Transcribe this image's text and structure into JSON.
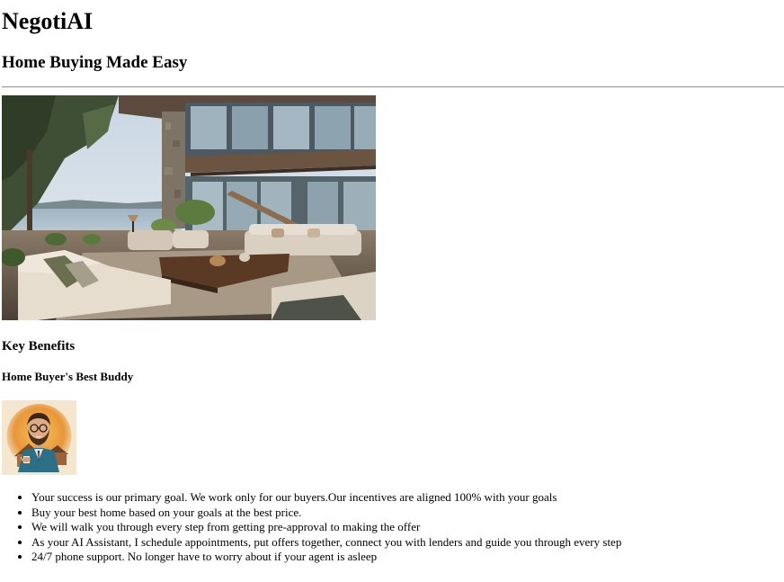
{
  "brand": {
    "name": "NegotiAI"
  },
  "hero": {
    "tagline": "Home Buying Made Easy",
    "image": "luxury-lakeside-living-room-photo"
  },
  "benefits_section": {
    "title": "Key Benefits",
    "subtitle": "Home Buyer's Best Buddy",
    "avatar": "bearded-assistant-with-house-illustration",
    "items": [
      "Your success is our primary goal. We work only for our buyers.Our incentives are aligned 100% with your goals",
      "Buy your best home based on your goals at the best price.",
      "We will walk you through every step from getting pre-approval to making the offer",
      "As your AI Assistant, I schedule appointments, put offers together, connect you with lenders and guide you through every step",
      "24/7 phone support. No longer have to worry about if your agent is asleep"
    ]
  },
  "colors": {
    "text": "#000000",
    "background": "#ffffff",
    "divider": "#9a9a9a"
  }
}
